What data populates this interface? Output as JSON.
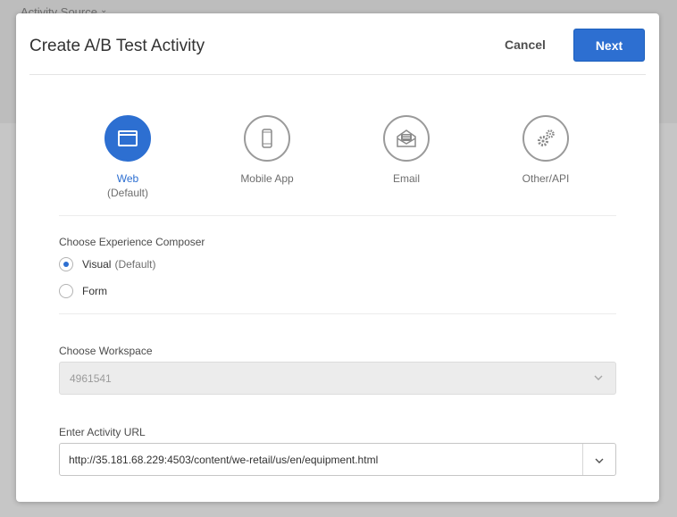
{
  "background": {
    "label": "Activity Source"
  },
  "dialog": {
    "title": "Create A/B Test Activity",
    "cancel_label": "Cancel",
    "next_label": "Next"
  },
  "channels": [
    {
      "label": "Web",
      "sub": "(Default)",
      "icon": "browser-window-icon",
      "selected": true
    },
    {
      "label": "Mobile App",
      "sub": "",
      "icon": "mobile-phone-icon",
      "selected": false
    },
    {
      "label": "Email",
      "sub": "",
      "icon": "envelope-icon",
      "selected": false
    },
    {
      "label": "Other/API",
      "sub": "",
      "icon": "gears-icon",
      "selected": false
    }
  ],
  "composer": {
    "label": "Choose Experience Composer",
    "options": [
      {
        "label": "Visual",
        "sub": "(Default)",
        "selected": true
      },
      {
        "label": "Form",
        "sub": "",
        "selected": false
      }
    ]
  },
  "workspace": {
    "label": "Choose Workspace",
    "value": "4961541"
  },
  "activity_url": {
    "label": "Enter Activity URL",
    "value": "http://35.181.68.229:4503/content/we-retail/us/en/equipment.html"
  },
  "colors": {
    "accent": "#2d6fd1",
    "dialog_bg": "#ffffff",
    "overlay": "#c9c9c9"
  }
}
